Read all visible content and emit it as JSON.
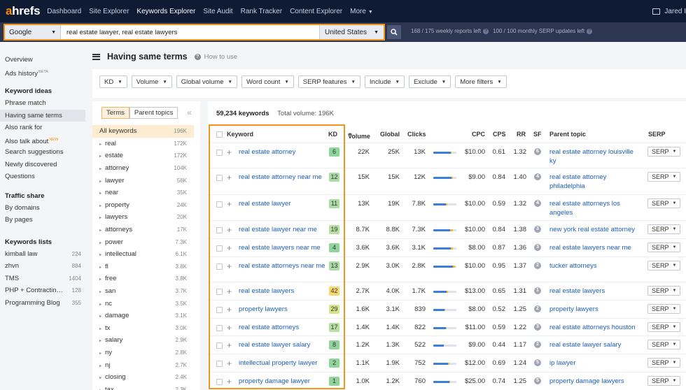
{
  "nav": {
    "logo_a": "a",
    "logo_rest": "hrefs",
    "items": [
      "Dashboard",
      "Site Explorer",
      "Keywords Explorer",
      "Site Audit",
      "Rank Tracker",
      "Content Explorer",
      "More"
    ],
    "user": "Jared I"
  },
  "search": {
    "engine": "Google",
    "keywords": "real estate lawyer, real estate lawyers",
    "country": "United States",
    "weekly_reports": "168 / 175 weekly reports left",
    "serp_updates": "100 / 100 monthly SERP updates left"
  },
  "sidebar": {
    "overview": "Overview",
    "ads_history": "Ads history",
    "beta": "BETA",
    "ideas_head": "Keyword ideas",
    "ideas": [
      "Phrase match",
      "Having same terms",
      "Also rank for",
      "Also talk about",
      "Search suggestions",
      "Newly discovered",
      "Questions"
    ],
    "new_badge": "NEW",
    "traffic_head": "Traffic share",
    "traffic": [
      "By domains",
      "By pages"
    ],
    "lists_head": "Keywords lists",
    "lists": [
      {
        "name": "kimball law",
        "count": "224"
      },
      {
        "name": "zhvn",
        "count": "884"
      },
      {
        "name": "TMS",
        "count": "1404"
      },
      {
        "name": "PHP + Contractin…",
        "count": "128"
      },
      {
        "name": "Programming Blog",
        "count": "355"
      }
    ]
  },
  "page": {
    "title": "Having same terms",
    "how_to": "How to use"
  },
  "filters": [
    "KD",
    "Volume",
    "Global volume",
    "Word count",
    "SERP features",
    "Include",
    "Exclude",
    "More filters"
  ],
  "terms": {
    "tabs": [
      "Terms",
      "Parent topics"
    ],
    "items": [
      {
        "name": "All keywords",
        "count": "196K"
      },
      {
        "name": "real",
        "count": "172K"
      },
      {
        "name": "estate",
        "count": "172K"
      },
      {
        "name": "attorney",
        "count": "104K"
      },
      {
        "name": "lawyer",
        "count": "56K"
      },
      {
        "name": "near",
        "count": "35K"
      },
      {
        "name": "property",
        "count": "24K"
      },
      {
        "name": "lawyers",
        "count": "20K"
      },
      {
        "name": "attorneys",
        "count": "17K"
      },
      {
        "name": "power",
        "count": "7.3K"
      },
      {
        "name": "intellectual",
        "count": "6.1K"
      },
      {
        "name": "fl",
        "count": "3.8K"
      },
      {
        "name": "free",
        "count": "3.8K"
      },
      {
        "name": "san",
        "count": "3.7K"
      },
      {
        "name": "nc",
        "count": "3.5K"
      },
      {
        "name": "damage",
        "count": "3.1K"
      },
      {
        "name": "tx",
        "count": "3.0K"
      },
      {
        "name": "salary",
        "count": "2.9K"
      },
      {
        "name": "ny",
        "count": "2.8K"
      },
      {
        "name": "nj",
        "count": "2.7K"
      },
      {
        "name": "closing",
        "count": "2.4K"
      },
      {
        "name": "tax",
        "count": "2.3K"
      }
    ]
  },
  "table": {
    "total_keywords": "59,234 keywords",
    "total_volume": "Total volume: 196K",
    "headers": {
      "keyword": "Keyword",
      "kd": "KD",
      "volume": "Volume",
      "global": "Global",
      "clicks": "Clicks",
      "cpc": "CPC",
      "cps": "CPS",
      "rr": "RR",
      "sf": "SF",
      "parent": "Parent topic",
      "serp": "SERP"
    },
    "serp_label": "SERP",
    "rows": [
      {
        "keyword": "real estate attorney",
        "kd": "6",
        "kd_color": "#8fd49a",
        "volume": "22K",
        "global": "25K",
        "clicks": "13K",
        "clicks_paid": 0.05,
        "clicks_organic": 0.75,
        "cpc": "$10.00",
        "cps": "0.61",
        "rr": "1.32",
        "sf": "6",
        "parent": "real estate attorney louisville ky"
      },
      {
        "keyword": "real estate attorney near me",
        "kd": "12",
        "kd_color": "#a9dba3",
        "volume": "15K",
        "global": "15K",
        "clicks": "12K",
        "clicks_paid": 0.08,
        "clicks_organic": 0.78,
        "cpc": "$9.00",
        "cps": "0.84",
        "rr": "1.40",
        "sf": "4",
        "parent": "real estate attorney philadelphia"
      },
      {
        "keyword": "real estate lawyer",
        "kd": "11",
        "kd_color": "#a9dba3",
        "volume": "13K",
        "global": "19K",
        "clicks": "7.8K",
        "clicks_paid": 0.05,
        "clicks_organic": 0.55,
        "cpc": "$10.00",
        "cps": "0.59",
        "rr": "1.32",
        "sf": "4",
        "parent": "real estate attorneys los angeles"
      },
      {
        "keyword": "real estate lawyer near me",
        "kd": "19",
        "kd_color": "#b7e0a0",
        "volume": "8.7K",
        "global": "8.8K",
        "clicks": "7.3K",
        "clicks_paid": 0.12,
        "clicks_organic": 0.74,
        "cpc": "$10.00",
        "cps": "0.84",
        "rr": "1.38",
        "sf": "3",
        "parent": "new york real estate attorney"
      },
      {
        "keyword": "real estate lawyers near me",
        "kd": "4",
        "kd_color": "#8fd49a",
        "volume": "3.6K",
        "global": "3.6K",
        "clicks": "3.1K",
        "clicks_paid": 0.1,
        "clicks_organic": 0.76,
        "cpc": "$8.00",
        "cps": "0.87",
        "rr": "1.36",
        "sf": "3",
        "parent": "real estate lawyers near me"
      },
      {
        "keyword": "real estate attorneys near me",
        "kd": "13",
        "kd_color": "#a9dba3",
        "volume": "2.9K",
        "global": "3.0K",
        "clicks": "2.8K",
        "clicks_paid": 0.1,
        "clicks_organic": 0.85,
        "cpc": "$10.00",
        "cps": "0.95",
        "rr": "1.37",
        "sf": "2",
        "parent": "tucker attorneys"
      },
      {
        "keyword": "real estate lawyers",
        "kd": "42",
        "kd_color": "#f5d76e",
        "volume": "2.7K",
        "global": "4.0K",
        "clicks": "1.7K",
        "clicks_paid": 0.07,
        "clicks_organic": 0.58,
        "cpc": "$13.00",
        "cps": "0.65",
        "rr": "1.31",
        "sf": "1",
        "parent": "real estate lawyers"
      },
      {
        "keyword": "property lawyers",
        "kd": "29",
        "kd_color": "#d6e58a",
        "volume": "1.6K",
        "global": "3.1K",
        "clicks": "839",
        "clicks_paid": 0.05,
        "clicks_organic": 0.47,
        "cpc": "$8.00",
        "cps": "0.52",
        "rr": "1.25",
        "sf": "2",
        "parent": "property lawyers"
      },
      {
        "keyword": "real estate attorneys",
        "kd": "17",
        "kd_color": "#b7e0a0",
        "volume": "1.4K",
        "global": "1.4K",
        "clicks": "822",
        "clicks_paid": 0.05,
        "clicks_organic": 0.54,
        "cpc": "$11.00",
        "cps": "0.59",
        "rr": "1.22",
        "sf": "3",
        "parent": "real estate attorneys houston"
      },
      {
        "keyword": "real estate lawyer salary",
        "kd": "8",
        "kd_color": "#8fd49a",
        "volume": "1.2K",
        "global": "1.3K",
        "clicks": "522",
        "clicks_paid": 0.0,
        "clicks_organic": 0.44,
        "cpc": "$9.00",
        "cps": "0.44",
        "rr": "1.17",
        "sf": "2",
        "parent": "real estate lawyer salary"
      },
      {
        "keyword": "intellectual property lawyer",
        "kd": "2",
        "kd_color": "#8fd49a",
        "volume": "1.1K",
        "global": "1.9K",
        "clicks": "752",
        "clicks_paid": 0.06,
        "clicks_organic": 0.63,
        "cpc": "$12.00",
        "cps": "0.69",
        "rr": "1.24",
        "sf": "5",
        "parent": "ip lawyer"
      },
      {
        "keyword": "property damage lawyer",
        "kd": "1",
        "kd_color": "#8fd49a",
        "volume": "1.0K",
        "global": "1.2K",
        "clicks": "760",
        "clicks_paid": 0.05,
        "clicks_organic": 0.69,
        "cpc": "$25.00",
        "cps": "0.74",
        "rr": "1.25",
        "sf": "5",
        "parent": "property damage lawyers"
      }
    ]
  }
}
